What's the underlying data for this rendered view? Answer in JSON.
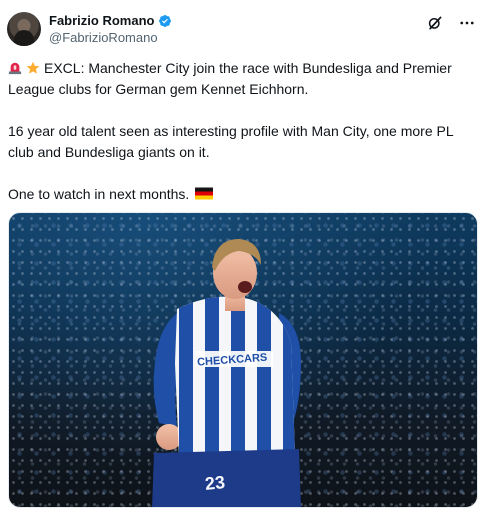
{
  "author": {
    "display_name": "Fabrizio Romano",
    "handle": "@FabrizioRomano",
    "verified": true,
    "avatar_icon": "avatar-photo"
  },
  "header_actions": {
    "grok_icon": "grok-icon",
    "more_icon": "more-icon"
  },
  "tweet": {
    "paragraph_1_emojis": [
      "siren-emoji",
      "star-emoji"
    ],
    "paragraph_1": "EXCL: Manchester City join the race with Bundesliga and Premier League clubs for German gem Kennet Eichhorn.",
    "paragraph_2": "16 year old talent seen as interesting profile with Man City, one more PL club and Bundesliga giants on it.",
    "paragraph_3": "One to watch in next months.",
    "paragraph_3_emoji": "germany-flag-emoji"
  },
  "media": {
    "shirt_sponsor": "CHECKCARS",
    "shirt_number": "23"
  },
  "colors": {
    "text": "#0f1419",
    "secondary_text": "#536471",
    "verified_blue": "#1d9bf0",
    "kit_blue": "#1f4fa6"
  }
}
